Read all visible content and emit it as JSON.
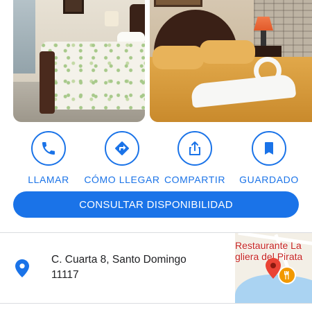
{
  "actions": [
    {
      "label": "LLAMAR",
      "icon": "phone-icon"
    },
    {
      "label": "CÓMO LLEGAR",
      "icon": "directions-icon"
    },
    {
      "label": "COMPARTIR",
      "icon": "share-icon"
    },
    {
      "label": "GUARDADO",
      "icon": "bookmark-icon"
    }
  ],
  "primary_button": {
    "label": "CONSULTAR DISPONIBILIDAD"
  },
  "address": {
    "line1": "C. Cuarta 8, Santo Domingo",
    "line2": "11117",
    "icon": "location-pin-icon"
  },
  "map": {
    "label_line1": "Restaurante La",
    "label_line2": "gliera del Pirata"
  },
  "photos": [
    {
      "name": "bedroom-photo-1"
    },
    {
      "name": "bedroom-photo-2"
    }
  ],
  "colors": {
    "accent": "#1a73e8",
    "map_label": "#c5221f",
    "food_marker": "#f29900",
    "text": "#202124"
  }
}
